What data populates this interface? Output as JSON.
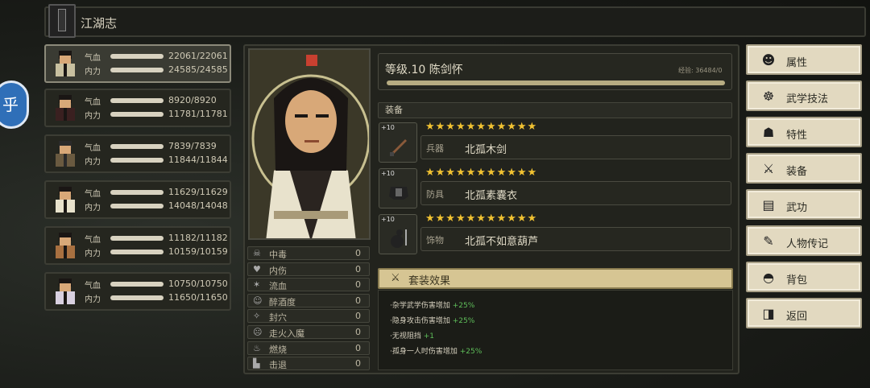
{
  "header": {
    "title": "江湖志"
  },
  "side_button": {
    "label": "乎"
  },
  "party": [
    {
      "hp_label": "气血",
      "hp": "22061/22061",
      "mp_label": "内力",
      "mp": "24585/24585"
    },
    {
      "hp_label": "气血",
      "hp": "8920/8920",
      "mp_label": "内力",
      "mp": "11781/11781"
    },
    {
      "hp_label": "气血",
      "hp": "7839/7839",
      "mp_label": "内力",
      "mp": "11844/11844"
    },
    {
      "hp_label": "气血",
      "hp": "11629/11629",
      "mp_label": "内力",
      "mp": "14048/14048"
    },
    {
      "hp_label": "气血",
      "hp": "11182/11182",
      "mp_label": "内力",
      "mp": "10159/10159"
    },
    {
      "hp_label": "气血",
      "hp": "10750/10750",
      "mp_label": "内力",
      "mp": "11650/11650"
    }
  ],
  "character": {
    "level_name": "等级.10 陈剑怀",
    "exp": "经验: 36484/0",
    "exp_fill": 1.0
  },
  "status": [
    {
      "icon": "skull-icon",
      "glyph": "☠",
      "name": "中毒",
      "value": "0"
    },
    {
      "icon": "broken-heart-icon",
      "glyph": "♥",
      "name": "内伤",
      "value": "0"
    },
    {
      "icon": "blood-icon",
      "glyph": "✶",
      "name": "流血",
      "value": "0"
    },
    {
      "icon": "drunk-icon",
      "glyph": "☺",
      "name": "醉酒度",
      "value": "0"
    },
    {
      "icon": "seal-icon",
      "glyph": "✧",
      "name": "封穴",
      "value": "0"
    },
    {
      "icon": "madness-icon",
      "glyph": "☹",
      "name": "走火入魔",
      "value": "0"
    },
    {
      "icon": "fire-icon",
      "glyph": "♨",
      "name": "燃烧",
      "value": "0"
    },
    {
      "icon": "knockback-icon",
      "glyph": "▙",
      "name": "击退",
      "value": "0"
    }
  ],
  "equipment": {
    "section_label": "装备",
    "items": [
      {
        "plus": "+10",
        "stars": "★★★★★★★★★★★",
        "type": "兵器",
        "name": "北孤木剑"
      },
      {
        "plus": "+10",
        "stars": "★★★★★★★★★★★",
        "type": "防具",
        "name": "北孤素囊衣"
      },
      {
        "plus": "+10",
        "stars": "★★★★★★★★★★★",
        "type": "饰物",
        "name": "北孤不如意葫芦"
      }
    ]
  },
  "set_effect": {
    "title": "套装效果",
    "effects": [
      {
        "text": "·杂学武学伤害增加",
        "bonus": "+25%"
      },
      {
        "text": "·隐身攻击伤害增加",
        "bonus": "+25%"
      },
      {
        "text": "·无视阻挡",
        "bonus": "+1"
      },
      {
        "text": "·孤身一人时伤害增加",
        "bonus": "+25%"
      }
    ]
  },
  "menu": [
    {
      "label": "属性",
      "icon": "person-icon",
      "glyph": "☻"
    },
    {
      "label": "武学技法",
      "icon": "martial-icon",
      "glyph": "☸"
    },
    {
      "label": "特性",
      "icon": "trait-icon",
      "glyph": "☗"
    },
    {
      "label": "装备",
      "icon": "sword-icon",
      "glyph": "⚔"
    },
    {
      "label": "武功",
      "icon": "book-icon",
      "glyph": "▤"
    },
    {
      "label": "人物传记",
      "icon": "biography-icon",
      "glyph": "✎"
    },
    {
      "label": "背包",
      "icon": "bag-icon",
      "glyph": "◓"
    },
    {
      "label": "返回",
      "icon": "door-icon",
      "glyph": "◨"
    }
  ]
}
